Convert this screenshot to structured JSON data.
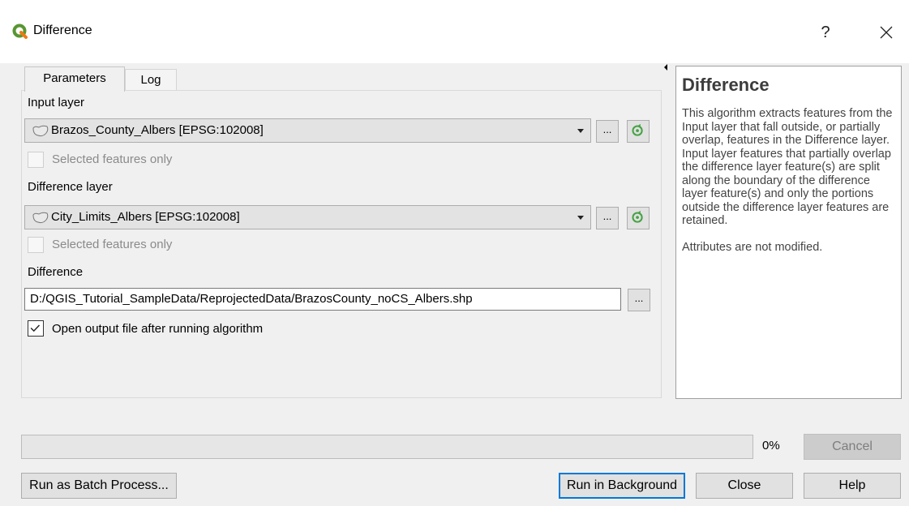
{
  "window": {
    "title": "Difference",
    "help_glyph": "?",
    "close_icon": "close-icon",
    "app_icon": "qgis-logo-icon",
    "accent_color": "#0078d7"
  },
  "tabs": [
    {
      "label": "Parameters",
      "active": true
    },
    {
      "label": "Log",
      "active": false
    }
  ],
  "params": {
    "input_layer": {
      "label": "Input layer",
      "value": "Brazos_County_Albers [EPSG:102008]",
      "selected_only_label": "Selected features only",
      "browse_label": "..."
    },
    "difference_layer": {
      "label": "Difference layer",
      "value": "City_Limits_Albers [EPSG:102008]",
      "selected_only_label": "Selected features only",
      "browse_label": "..."
    },
    "output": {
      "label": "Difference",
      "value": "D:/QGIS_Tutorial_SampleData/ReprojectedData/BrazosCounty_noCS_Albers.shp",
      "browse_label": "..."
    },
    "open_output": {
      "label": "Open output file after running algorithm",
      "checked": true
    }
  },
  "help": {
    "title": "Difference",
    "body": "This algorithm extracts features from the Input layer that fall outside, or partially overlap, features in the Difference layer. Input layer features that partially overlap the difference layer feature(s) are split along the boundary of the difference layer feature(s) and only the portions outside the difference layer features are retained.",
    "attributes_note": "Attributes are not modified."
  },
  "progress": {
    "value": 0,
    "text": "0%"
  },
  "buttons": {
    "cancel": "Cancel",
    "batch": "Run as Batch Process...",
    "run_background": "Run in Background",
    "close": "Close",
    "help": "Help"
  }
}
